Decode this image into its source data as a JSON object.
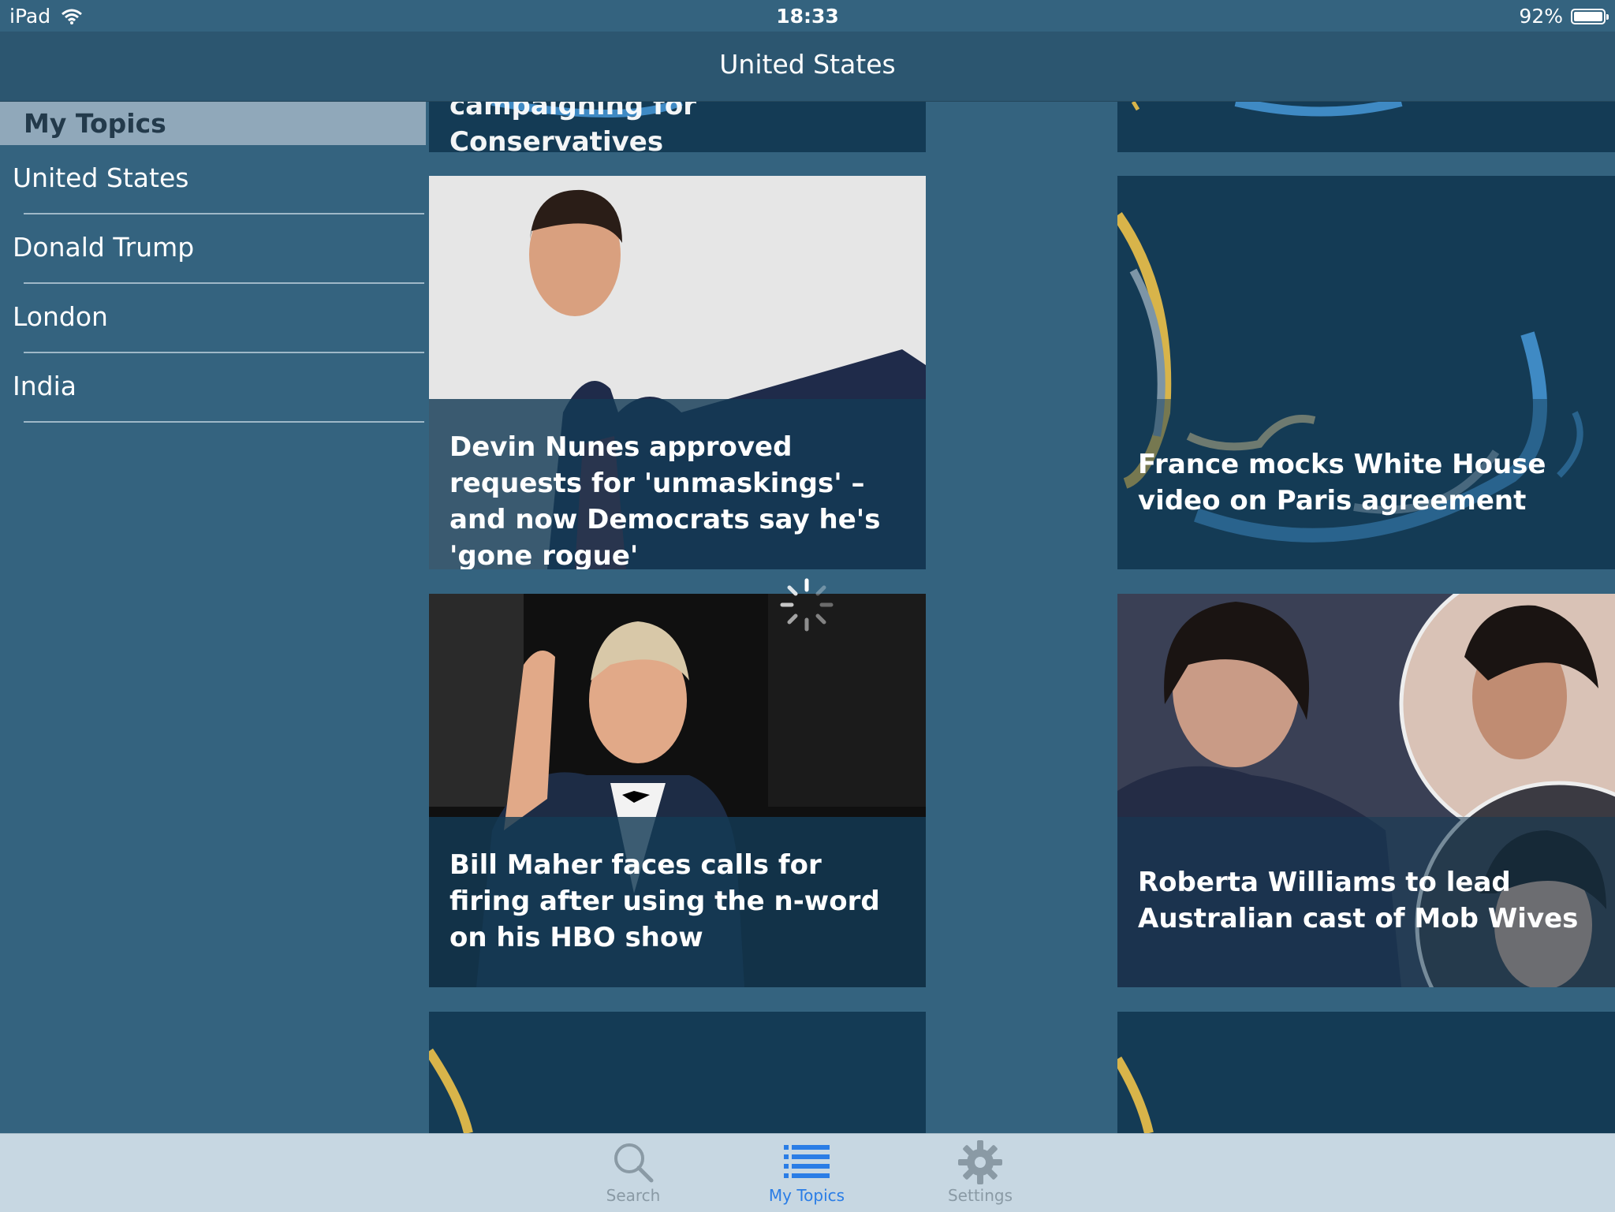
{
  "status": {
    "device": "iPad",
    "time": "18:33",
    "battery": "92%"
  },
  "navbar": {
    "title": "United States"
  },
  "sidebar": {
    "header": "My Topics",
    "items": [
      {
        "label": "United States"
      },
      {
        "label": "Donald Trump"
      },
      {
        "label": "London"
      },
      {
        "label": "India"
      }
    ]
  },
  "cards": [
    {
      "headline": "campaigning for Conservatives"
    },
    {
      "headline": "Devin Nunes approved requests for 'unmaskings' – and now Democrats say he's 'gone rogue'"
    },
    {
      "headline": "France mocks White House video on Paris agreement"
    },
    {
      "headline": "Bill Maher faces calls for firing after using the n-word on his HBO show"
    },
    {
      "headline": "Roberta Williams to lead Australian cast of Mob Wives"
    }
  ],
  "tabbar": {
    "tabs": [
      {
        "label": "Search",
        "icon": "search-icon"
      },
      {
        "label": "My Topics",
        "icon": "list-icon",
        "active": true
      },
      {
        "label": "Settings",
        "icon": "gear-icon"
      }
    ]
  },
  "colors": {
    "background": "#34637f",
    "card": "#143b55",
    "accent": "#2a7de6",
    "sidebar_header": "#90a8ba"
  }
}
